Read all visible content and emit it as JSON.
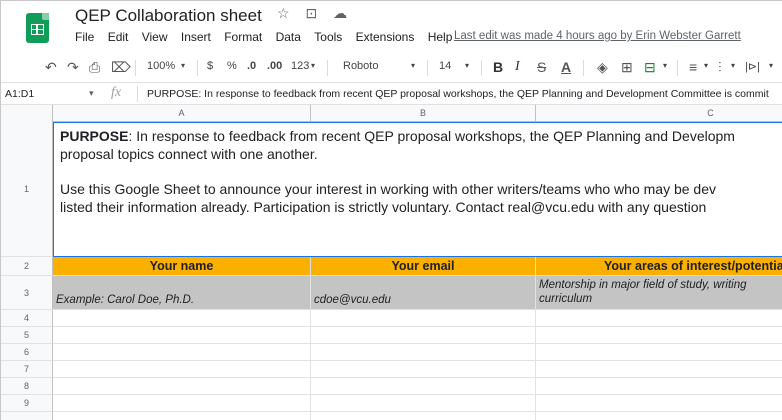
{
  "titlebar": {
    "doc_title": "QEP Collaboration sheet",
    "star_icon": "☆",
    "move_icon": "⊡",
    "cloud_icon": "☁",
    "menu": [
      "File",
      "Edit",
      "View",
      "Insert",
      "Format",
      "Data",
      "Tools",
      "Extensions",
      "Help"
    ],
    "last_edit": "Last edit was made 4 hours ago by Erin Webster Garrett"
  },
  "toolbar": {
    "undo": "↶",
    "redo": "↷",
    "print": "⎙",
    "paint_format": "⌦",
    "zoom": "100%",
    "zoom_arrow": "▾",
    "currency": "$",
    "percent": "%",
    "decrease_decimal": ".0",
    "increase_decimal": ".00",
    "number_format": "123",
    "number_format_arrow": "▾",
    "font": "Roboto",
    "font_arrow": "▾",
    "font_size": "14",
    "font_size_arrow": "▾",
    "bold": "B",
    "italic": "I",
    "strike": "S",
    "text_color": "A",
    "fill": "◈",
    "borders": "⊞",
    "merge": "⊟",
    "merge_arrow": "▾",
    "align": "≡",
    "align_arrow": "▾",
    "valign": "⫶",
    "valign_arrow": "▾",
    "wrap": "|⊳|",
    "wrap_arrow": "▾"
  },
  "formula_bar": {
    "name_box": "A1:D1",
    "name_box_arrow": "▾",
    "fx": "fx",
    "formula": "PURPOSE:  In response to feedback from recent QEP proposal workshops, the QEP Planning and Development Committee is commit"
  },
  "grid": {
    "columns": [
      "A",
      "B",
      "C"
    ],
    "rows": [
      "1",
      "2",
      "3",
      "4",
      "5",
      "6",
      "7",
      "8",
      "9"
    ],
    "purpose": {
      "label": "PURPOSE",
      "line1_rest": ":  In response to feedback from recent QEP proposal workshops, the QEP Planning and Developm",
      "line2": "proposal topics connect with one another.",
      "line3": "Use this Google Sheet to announce your interest in working with other writers/teams who who may be dev",
      "line4": "listed their information already.  Participation is strictly voluntary. Contact real@vcu.edu with any question"
    },
    "header": {
      "name": "Your name",
      "email": "Your email",
      "areas": "Your areas of interest/potential Q"
    },
    "example": {
      "name": "Example: Carol Doe, Ph.D.",
      "email": "cdoe@vcu.edu",
      "areas_line1": "Mentorship in major field of study, writing",
      "areas_line2": "curriculum"
    }
  },
  "colors": {
    "header_fill": "#fbb000",
    "example_fill": "#c4c4c4",
    "selection": "#1a73e8",
    "sheets_green": "#0f9d58"
  }
}
